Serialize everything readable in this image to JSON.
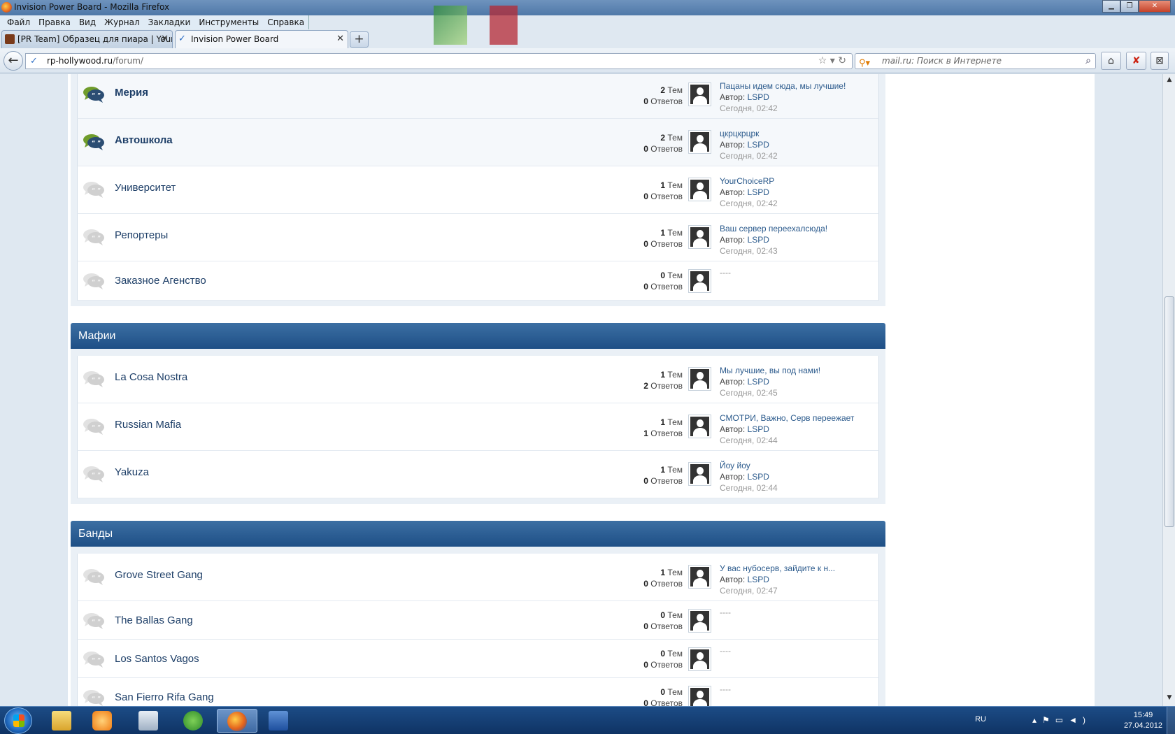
{
  "window": {
    "title": "Invision Power Board - Mozilla Firefox"
  },
  "menu": [
    "Файл",
    "Правка",
    "Вид",
    "Журнал",
    "Закладки",
    "Инструменты",
    "Справка"
  ],
  "tabs": [
    {
      "label": "[PR Team] Образец для пиара | Your...",
      "active": false
    },
    {
      "label": "Invision Power Board",
      "active": true
    }
  ],
  "url": {
    "host": "rp-hollywood.ru",
    "path": "/forum/"
  },
  "search": {
    "placeholder": "mail.ru: Поиск в Интернете"
  },
  "stats_labels": {
    "topics": "Тем",
    "replies": "Ответов"
  },
  "author_label": "Автор:",
  "categories": [
    {
      "title": "",
      "forums": [
        {
          "name": "Мерия",
          "unread": true,
          "topics": "2",
          "replies": "0",
          "last_title": "Пацаны идем сюда, мы лучшие!",
          "last_author": "LSPD",
          "last_date": "Сегодня, 02:42"
        },
        {
          "name": "Автошкола",
          "unread": true,
          "topics": "2",
          "replies": "0",
          "last_title": "цкрцкрцрк",
          "last_author": "LSPD",
          "last_date": "Сегодня, 02:42"
        },
        {
          "name": "Университет",
          "unread": false,
          "topics": "1",
          "replies": "0",
          "last_title": "YourChoiceRP",
          "last_author": "LSPD",
          "last_date": "Сегодня, 02:42"
        },
        {
          "name": "Репортеры",
          "unread": false,
          "topics": "1",
          "replies": "0",
          "last_title": "Ваш сервер переехалсюда!",
          "last_author": "LSPD",
          "last_date": "Сегодня, 02:43"
        },
        {
          "name": "Заказное Агенство",
          "unread": false,
          "topics": "0",
          "replies": "0",
          "last_title": "----",
          "last_author": "",
          "last_date": ""
        }
      ]
    },
    {
      "title": "Мафии",
      "forums": [
        {
          "name": "La Cosa Nostra",
          "unread": false,
          "topics": "1",
          "replies": "2",
          "last_title": "Мы лучшие, вы под нами!",
          "last_author": "LSPD",
          "last_date": "Сегодня, 02:45"
        },
        {
          "name": "Russian Mafia",
          "unread": false,
          "topics": "1",
          "replies": "1",
          "last_title": "СМОТРИ, Важно, Серв переежает",
          "last_author": "LSPD",
          "last_date": "Сегодня, 02:44"
        },
        {
          "name": "Yakuza",
          "unread": false,
          "topics": "1",
          "replies": "0",
          "last_title": "Йоу йоу",
          "last_author": "LSPD",
          "last_date": "Сегодня, 02:44"
        }
      ]
    },
    {
      "title": "Банды",
      "forums": [
        {
          "name": "Grove Street Gang",
          "unread": false,
          "topics": "1",
          "replies": "0",
          "last_title": "У вас нубосерв, зайдите к н...",
          "last_author": "LSPD",
          "last_date": "Сегодня, 02:47"
        },
        {
          "name": "The Ballas Gang",
          "unread": false,
          "topics": "0",
          "replies": "0",
          "last_title": "----",
          "last_author": "",
          "last_date": ""
        },
        {
          "name": "Los Santos Vagos",
          "unread": false,
          "topics": "0",
          "replies": "0",
          "last_title": "----",
          "last_author": "",
          "last_date": ""
        },
        {
          "name": "San Fierro Rifa Gang",
          "unread": false,
          "topics": "0",
          "replies": "0",
          "last_title": "----",
          "last_author": "",
          "last_date": ""
        }
      ]
    }
  ],
  "taskbar": {
    "apps": [
      "explorer-icon",
      "media-player-icon",
      "calculator-icon",
      "utorrent-icon",
      "firefox-icon",
      "word-icon"
    ],
    "language": "RU",
    "time": "15:49",
    "date": "27.04.2012"
  }
}
